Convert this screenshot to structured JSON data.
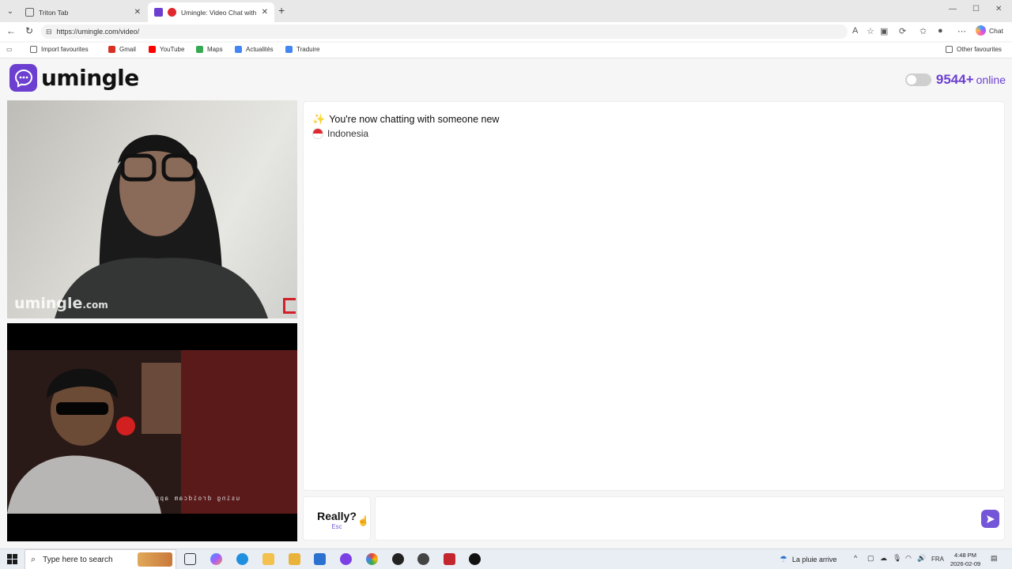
{
  "browser": {
    "tabs": [
      {
        "title": "Triton Tab"
      },
      {
        "title": "Umingle: Video Chat with Stra"
      }
    ],
    "address": "https://umingle.com/video/",
    "chat_label": "Chat",
    "bookmarks": [
      "Import favourites",
      "Gmail",
      "YouTube",
      "Maps",
      "Actualités",
      "Traduire"
    ],
    "other_favourites": "Other favourites"
  },
  "header": {
    "logo_text": "umingle",
    "online_count": "9544+",
    "online_label": "online"
  },
  "video": {
    "remote_watermark": "umingle",
    "remote_watermark_suffix": ".com",
    "local_overlay": "using droidcam app"
  },
  "chat": {
    "status_text": "You're now chatting with someone new",
    "country": "Indonesia"
  },
  "controls": {
    "skip_label": "Really?",
    "skip_key": "Esc",
    "message_placeholder": ""
  },
  "taskbar": {
    "search_placeholder": "Type here to search",
    "weather": "La pluie arrive",
    "language": "FRA",
    "time": "4:48 PM",
    "date": "2026-02-09"
  }
}
